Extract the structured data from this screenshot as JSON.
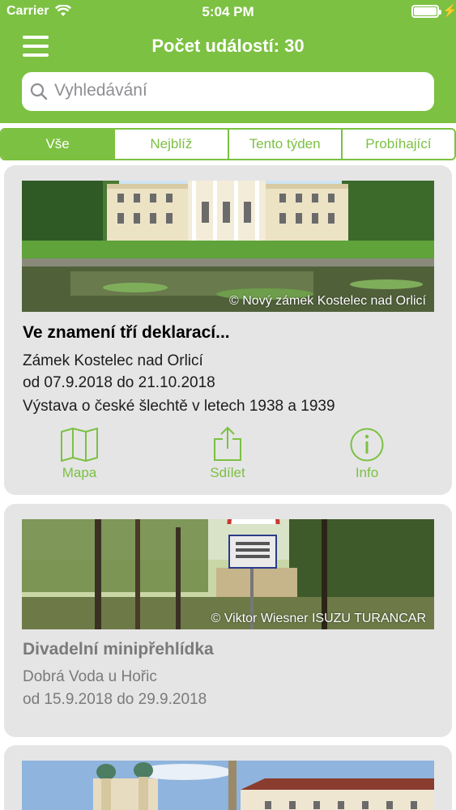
{
  "status_bar": {
    "carrier": "Carrier",
    "time": "5:04 PM"
  },
  "header": {
    "title": "Počet událostí: 30"
  },
  "search": {
    "placeholder": "Vyhledávání"
  },
  "tabs": [
    {
      "label": "Vše",
      "active": true
    },
    {
      "label": "Nejblíž",
      "active": false
    },
    {
      "label": "Tento týden",
      "active": false
    },
    {
      "label": "Probíhající",
      "active": false
    }
  ],
  "events": [
    {
      "image_credit": "© Nový zámek Kostelec nad Orlicí",
      "title": "Ve znamení tří deklarací...",
      "place": "Zámek Kostelec nad Orlicí",
      "dates": "od 07.9.2018 do 21.10.2018",
      "description": "Výstava o české šlechtě v letech 1938 a 1939",
      "actions": {
        "map": "Mapa",
        "share": "Sdílet",
        "info": "Info"
      }
    },
    {
      "image_credit": "© Viktor Wiesner ISUZU TURANCAR",
      "title": "Divadelní minipřehlídka",
      "place": "Dobrá Voda u Hořic",
      "dates": "od 15.9.2018 do 29.9.2018"
    },
    {}
  ],
  "colors": {
    "accent": "#7cc142",
    "card_bg": "#e5e5e5"
  }
}
